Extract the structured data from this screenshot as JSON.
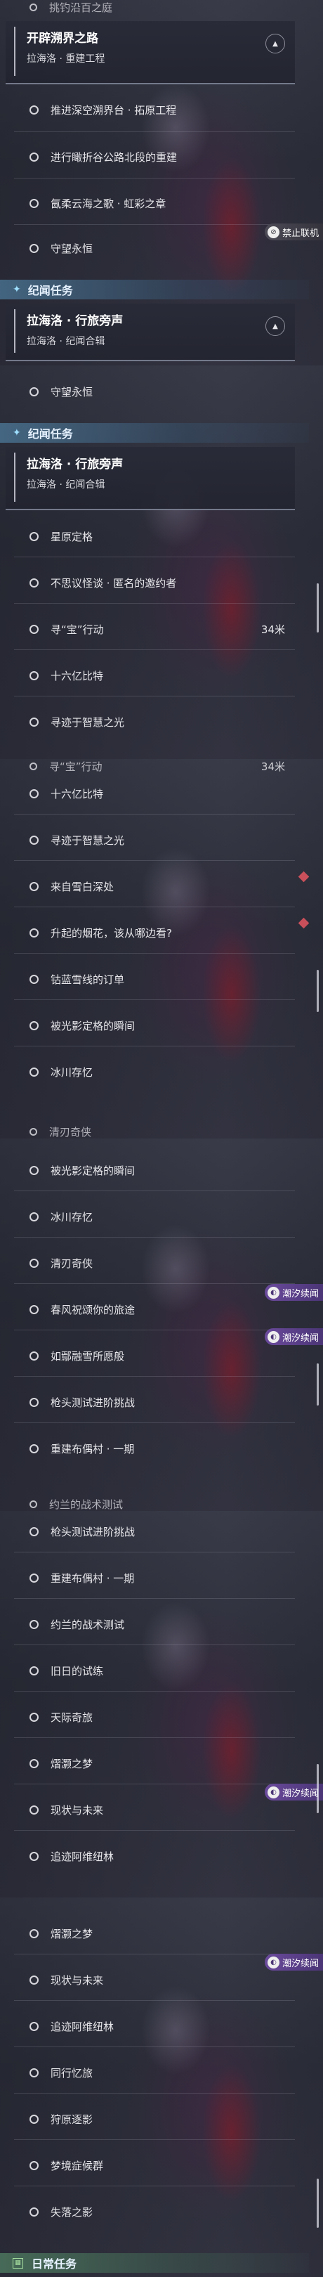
{
  "frame1": {
    "top_partial": "挑钓沿百之庭",
    "group": {
      "title": "开辟溯界之路",
      "subtitle": "拉海洛 · 重建工程",
      "toggle": "▲"
    },
    "items": [
      "推进深空溯界台 · 拓原工程",
      "进行瞰折谷公路北段的重建",
      "氤柔云海之歌 · 虹彩之章",
      "守望永恒"
    ],
    "badge": "禁止联机",
    "section": "纪闻任务",
    "group2": {
      "title": "拉海洛 · 行旅旁声",
      "subtitle": "拉海洛 · 纪闻合辑",
      "toggle": "▲"
    }
  },
  "frame2": {
    "items_top": [
      "守望永恒"
    ],
    "section": "纪闻任务",
    "group": {
      "title": "拉海洛 · 行旅旁声",
      "subtitle": "拉海洛 · 纪闻合辑"
    },
    "items": [
      "星原定格",
      "不思议怪谈 · 匿名的邀约者",
      "寻“宝”行动",
      "十六亿比特",
      "寻迹于智慧之光"
    ],
    "distance": "34米"
  },
  "frame3": {
    "top_partial": "寻“宝”行动",
    "top_partial_distance": "34米",
    "items": [
      "十六亿比特",
      "寻迹于智慧之光",
      "来自雪白深处",
      "升起的烟花，该从哪边看?",
      "钴蓝雪线的订单",
      "被光影定格的瞬间",
      "冰川存忆"
    ],
    "bottom_partial": "清刃奇侠"
  },
  "frame4": {
    "items": [
      "被光影定格的瞬间",
      "冰川存忆",
      "清刃奇侠",
      "春风祝颂你的旅途",
      "如鄢融雪所愿般",
      "枪头测试进阶挑战",
      "重建布偶村 · 一期"
    ],
    "badge": "潮汐续闻",
    "bottom_partial": "约兰的战术测试"
  },
  "frame5": {
    "items": [
      "枪头测试进阶挑战",
      "重建布偶村 · 一期",
      "约兰的战术测试",
      "旧日的试练",
      "天际奇旅",
      "熠灏之梦",
      "现状与未来",
      "追迹阿维纽林"
    ],
    "badge": "潮汐续闻"
  },
  "frame6": {
    "items": [
      "熠灏之梦",
      "现状与未来",
      "追迹阿维纽林",
      "同行忆旅",
      "狩原逐影",
      "梦境症候群",
      "失落之影"
    ],
    "badge": "潮汐续闻",
    "section": "日常任务"
  }
}
